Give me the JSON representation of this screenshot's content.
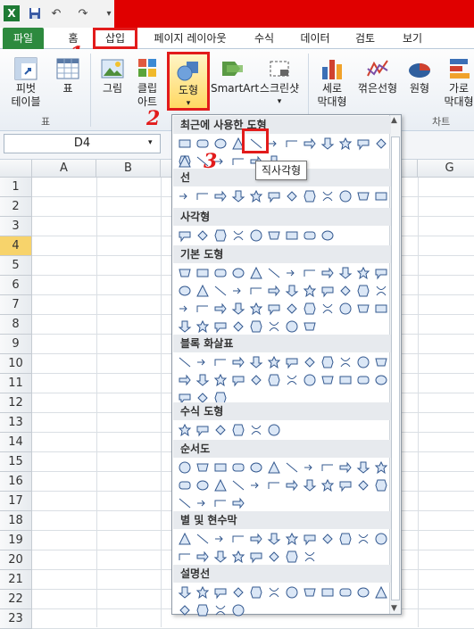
{
  "tabs": {
    "file": "파일",
    "home": "홈",
    "insert": "삽입",
    "layout": "페이지 레이아웃",
    "formulas": "수식",
    "data": "데이터",
    "review": "검토",
    "view": "보기"
  },
  "ribbon": {
    "pivot": "피벗",
    "pivot2": "테이블",
    "table": "표",
    "picture": "그림",
    "clip1": "클립",
    "clip2": "아트",
    "shapes": "도형",
    "smartart": "SmartArt",
    "screenshot": "스크린샷",
    "bar1": "세로",
    "bar2": "막대형",
    "line": "꺾은선형",
    "pie": "원형",
    "hbar1": "가로",
    "hbar2": "막대형",
    "group_table": "표",
    "group_chart": "차트"
  },
  "namebox": "D4",
  "columns": [
    "A",
    "B",
    "G"
  ],
  "rows": [
    "1",
    "2",
    "3",
    "4",
    "5",
    "6",
    "7",
    "8",
    "9",
    "10",
    "11",
    "12",
    "13",
    "14",
    "15",
    "16",
    "17",
    "18",
    "19",
    "20",
    "21",
    "22",
    "23"
  ],
  "dropdown": {
    "recent": "최근에 사용한 도형",
    "lines": "선",
    "rect": "사각형",
    "basic": "기본 도형",
    "arrows": "블록 화살표",
    "equation": "수식 도형",
    "flowchart": "순서도",
    "stars": "별 및 현수막",
    "callouts": "설명선"
  },
  "tooltip": "직사각형",
  "marks": {
    "m1": "1",
    "m2": "2",
    "m3": "3"
  },
  "colors": {
    "file_tab": "#2d8a3e",
    "highlight": "#e21b1b",
    "titlebar": "#e00000"
  }
}
